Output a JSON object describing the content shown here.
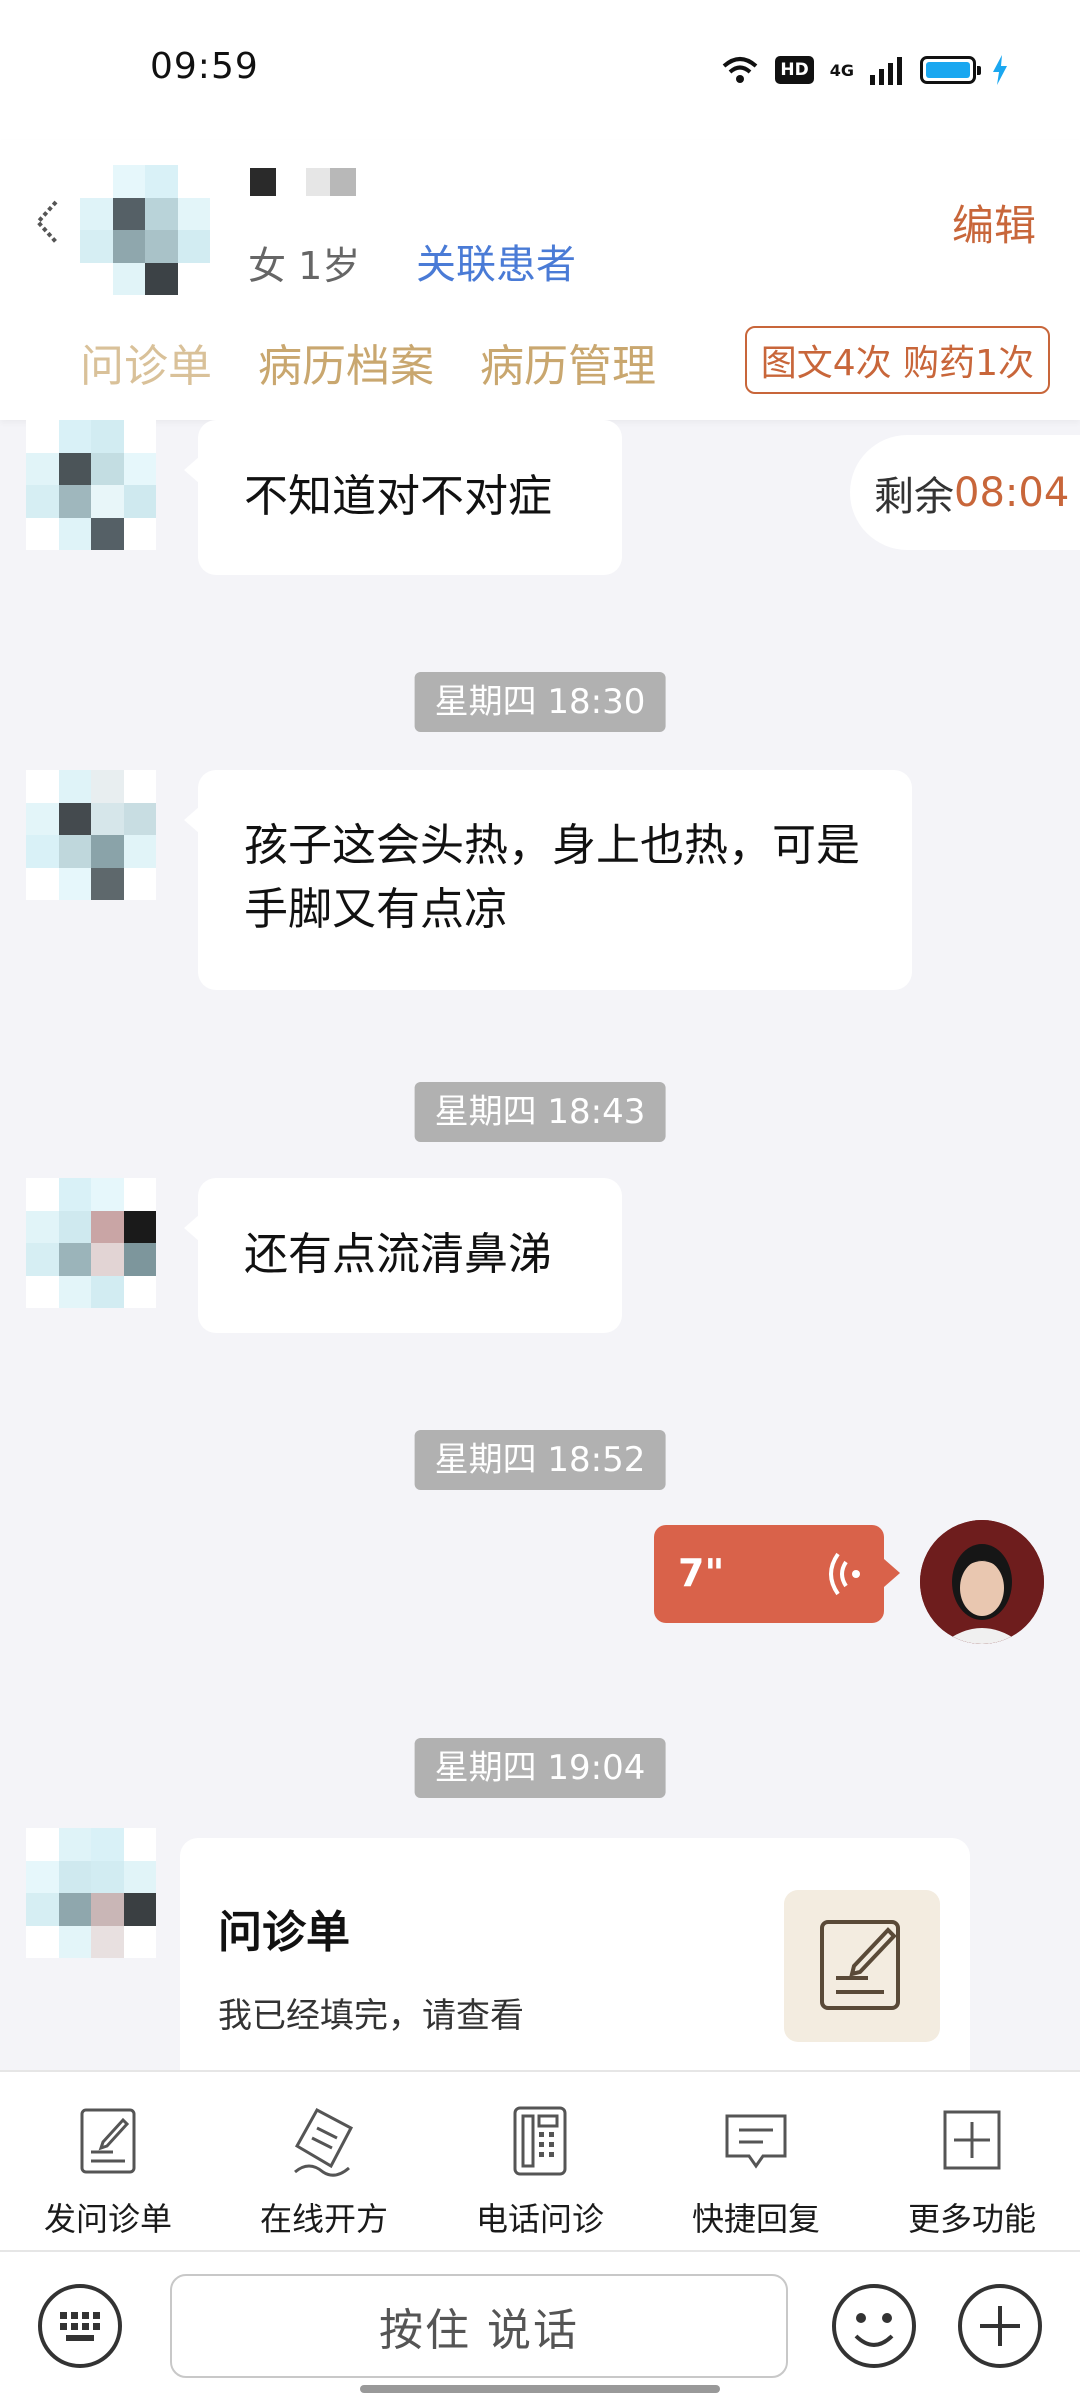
{
  "status_bar": {
    "time": "09:59",
    "hd": "HD",
    "network": "4G"
  },
  "header": {
    "patient_meta": "女 1岁",
    "link_label": "关联患者",
    "edit_label": "编辑",
    "tabs": [
      {
        "label": "问诊单"
      },
      {
        "label": "病历档案"
      },
      {
        "label": "病历管理"
      }
    ],
    "quota_badge": "图文4次 购药1次"
  },
  "remaining": {
    "label": "剩余",
    "value": "08:04"
  },
  "messages": {
    "m1": "不知道对不对症",
    "t1": "星期四 18:30",
    "m2": "孩子这会头热，身上也热，可是手脚又有点凉",
    "t2": "星期四 18:43",
    "m3": "还有点流清鼻涕",
    "t3": "星期四 18:52",
    "voice_duration": "7\"",
    "t4": "星期四 19:04",
    "card_title": "问诊单",
    "card_subtitle": "我已经填完，请查看"
  },
  "toolbar": {
    "items": [
      {
        "label": "发问诊单",
        "icon": "form-edit-icon"
      },
      {
        "label": "在线开方",
        "icon": "prescription-icon"
      },
      {
        "label": "电话问诊",
        "icon": "phone-icon"
      },
      {
        "label": "快捷回复",
        "icon": "quick-reply-icon"
      },
      {
        "label": "更多功能",
        "icon": "plus-square-icon"
      }
    ]
  },
  "input_bar": {
    "hold_to_talk": "按住 说话"
  },
  "colors": {
    "accent": "#c8663a",
    "link": "#4a7bd6",
    "tab": "#c9a76f",
    "voice": "#d9624a",
    "time_pill": "#b1b1b1"
  }
}
